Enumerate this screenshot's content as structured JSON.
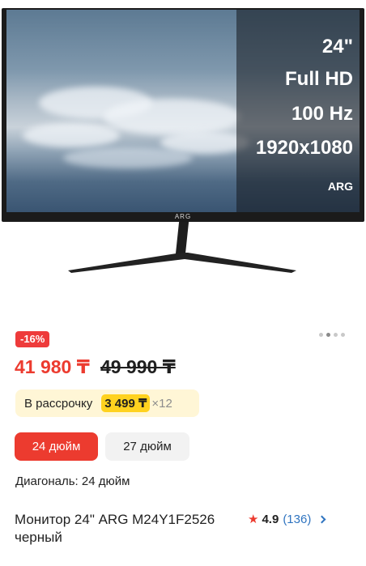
{
  "product_image": {
    "specs": {
      "size": "24\"",
      "resolution_label": "Full HD",
      "refresh": "100 Hz",
      "pixels": "1920x1080",
      "brand_badge": "ARG"
    },
    "bezel_logo": "ARG"
  },
  "gallery": {
    "total": 4,
    "active_index": 2
  },
  "discount": "-16%",
  "price": {
    "current": "41 980 ₸",
    "old": "49 990 ₸"
  },
  "installment": {
    "label": "В рассрочку",
    "amount": "3 499 ₸",
    "multiplier": "×12"
  },
  "size_options": [
    {
      "label": "24 дюйм",
      "selected": true
    },
    {
      "label": "27 дюйм",
      "selected": false
    }
  ],
  "diagonal_text": "Диагональ: 24 дюйм",
  "product": {
    "title": "Монитор 24\" ARG M24Y1F2526 черный"
  },
  "rating": {
    "value": "4.9",
    "reviews": "(136)"
  },
  "colors": {
    "accent": "#ec3b2f",
    "discount_badge": "#ee3b3b",
    "installment_bg": "#fff6d6",
    "installment_highlight": "#ffd21f",
    "link": "#2f74c0"
  },
  "icons": {
    "rating": "star-icon",
    "more": "chevron-right-icon"
  }
}
